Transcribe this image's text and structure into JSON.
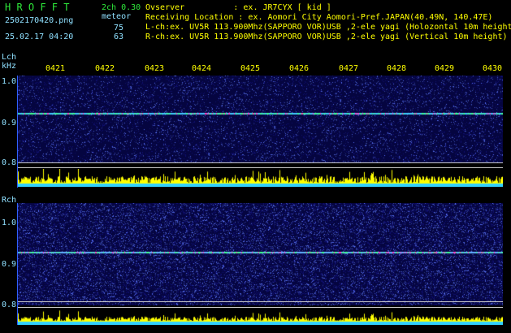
{
  "header": {
    "logo": "H R O F F T",
    "filename": "2502170420.png",
    "datetime": "25.02.17 04:20",
    "ch_label": "2ch 0.30",
    "meteor_label": "meteor",
    "lch_count": "75",
    "rch_count": "63",
    "observer_line": "Ovserver          : ex. JR7CYX [ kid ]",
    "location_line": "Receiving Location : ex. Aomori City Aomori-Pref.JAPAN(40.49N, 140.47E)",
    "lch_line": "L-ch:ex. UV5R 113.900Mhz(SAPPORO VOR)USB ,2-ele yagi (Holozontal 10m height)",
    "rch_line": "R-ch:ex. UV5R 113.900Mhz(SAPPORO VOR)USB ,2-ele yagi (Vertical 10m height)"
  },
  "lch": {
    "channel_label": "Lch",
    "unit_label": "kHz",
    "y_ticks": [
      "1.0",
      "0.9",
      "0.8"
    ],
    "time_ticks": [
      "0421",
      "0422",
      "0423",
      "0424",
      "0425",
      "0426",
      "0427",
      "0428",
      "0429",
      "0430"
    ]
  },
  "rch": {
    "channel_label": "Rch",
    "y_ticks": [
      "1.0",
      "0.9",
      "0.8"
    ]
  },
  "colors": {
    "header_green": "#2ee83a",
    "header_cyan": "#8fe0ff",
    "trace": "#ffff00",
    "baseline": "#40e0ff",
    "noise_bg": "#0a0a6e"
  }
}
